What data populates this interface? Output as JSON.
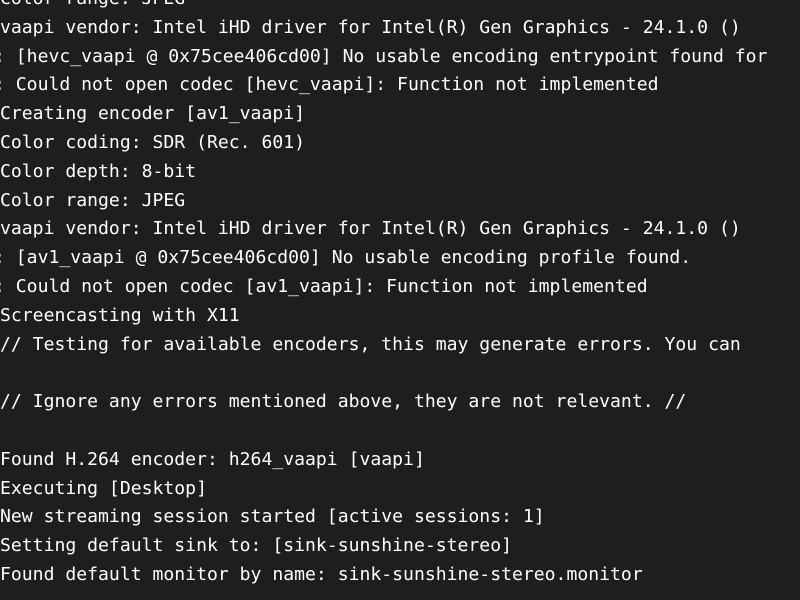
{
  "terminal": {
    "lines": [
      {
        "text": "Color range: JPEG"
      },
      {
        "text": "vaapi vendor: Intel iHD driver for Intel(R) Gen Graphics - 24.1.0 ()"
      },
      {
        "text": ": [hevc_vaapi @ 0x75cee406cd00] No usable encoding entrypoint found for"
      },
      {
        "text": ": Could not open codec [hevc_vaapi]: Function not implemented"
      },
      {
        "text": "Creating encoder [av1_vaapi]"
      },
      {
        "text": "Color coding: SDR (Rec. 601)"
      },
      {
        "text": "Color depth: 8-bit"
      },
      {
        "text": "Color range: JPEG"
      },
      {
        "text": "vaapi vendor: Intel iHD driver for Intel(R) Gen Graphics - 24.1.0 ()"
      },
      {
        "text": ": [av1_vaapi @ 0x75cee406cd00] No usable encoding profile found."
      },
      {
        "text": ": Could not open codec [av1_vaapi]: Function not implemented"
      },
      {
        "text": "Screencasting with X11"
      },
      {
        "text": "// Testing for available encoders, this may generate errors. You can"
      },
      {
        "text": ""
      },
      {
        "text": "// Ignore any errors mentioned above, they are not relevant. //"
      },
      {
        "text": ""
      },
      {
        "text": "Found H.264 encoder: h264_vaapi [vaapi]"
      },
      {
        "text": "Executing [Desktop]"
      },
      {
        "text": "New streaming session started [active sessions: 1]"
      },
      {
        "text": "Setting default sink to: [sink-sunshine-stereo]"
      },
      {
        "text": "Found default monitor by name: sink-sunshine-stereo.monitor"
      }
    ]
  }
}
